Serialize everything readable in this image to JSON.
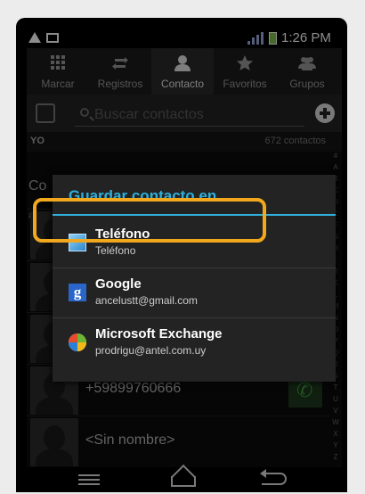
{
  "status_bar": {
    "time": "1:26 PM"
  },
  "tabs": [
    {
      "label": "Marcar",
      "icon": "dialpad-icon",
      "active": false
    },
    {
      "label": "Registros",
      "icon": "call-log-icon",
      "active": false
    },
    {
      "label": "Contacto",
      "icon": "person-icon",
      "active": true
    },
    {
      "label": "Favoritos",
      "icon": "star-icon",
      "active": false
    },
    {
      "label": "Grupos",
      "icon": "group-icon",
      "active": false
    }
  ],
  "search": {
    "placeholder": "Buscar contactos"
  },
  "list": {
    "yo_label": "YO",
    "count": "672 contactos",
    "section_co": "Co",
    "section_hash": "#",
    "alphabet": [
      "#",
      "A",
      "B",
      "C",
      "D",
      "E",
      "F",
      "G",
      "H",
      "I",
      "J",
      "K",
      "L",
      "M",
      "N",
      "O",
      "P",
      "Q",
      "R",
      "S",
      "T",
      "U",
      "V",
      "W",
      "X",
      "Y",
      "Z"
    ],
    "rows": [
      {
        "name": "+59899760666",
        "has_call": true
      },
      {
        "name": "<Sin nombre>",
        "has_call": false
      }
    ]
  },
  "dialog": {
    "title": "Guardar contacto en",
    "options": [
      {
        "title": "Teléfono",
        "subtitle": "Teléfono",
        "icon": "phone-book-icon",
        "selected": true
      },
      {
        "title": "Google",
        "subtitle": "ancelustt@gmail.com",
        "icon": "google-icon",
        "selected": false
      },
      {
        "title": "Microsoft Exchange",
        "subtitle": "prodrigu@antel.com.uy",
        "icon": "exchange-icon",
        "selected": false
      }
    ]
  },
  "colors": {
    "accent": "#2fb1dc",
    "highlight": "#f1a81e",
    "dialog_bg": "#232323"
  }
}
